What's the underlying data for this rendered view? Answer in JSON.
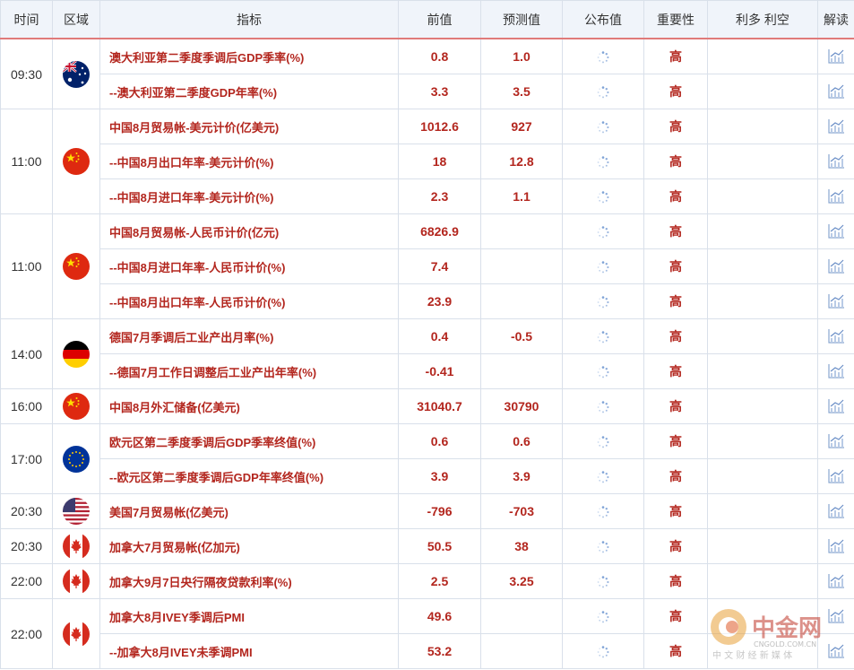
{
  "header": {
    "time": "时间",
    "region": "区域",
    "indicator": "指标",
    "previous": "前值",
    "forecast": "预测值",
    "actual": "公布值",
    "importance": "重要性",
    "effect": "利多 利空",
    "analysis": "解读"
  },
  "groups": [
    {
      "time": "09:30",
      "flag": "australia-flag",
      "rows": [
        {
          "indicator": "澳大利亚第二季度季调后GDP季率(%)",
          "previous": "0.8",
          "forecast": "1.0",
          "importance": "高"
        },
        {
          "indicator": "--澳大利亚第二季度GDP年率(%)",
          "previous": "3.3",
          "forecast": "3.5",
          "importance": "高"
        }
      ]
    },
    {
      "time": "11:00",
      "flag": "china-flag",
      "rows": [
        {
          "indicator": "中国8月贸易帐-美元计价(亿美元)",
          "previous": "1012.6",
          "forecast": "927",
          "importance": "高"
        },
        {
          "indicator": "--中国8月出口年率-美元计价(%)",
          "previous": "18",
          "forecast": "12.8",
          "importance": "高"
        },
        {
          "indicator": "--中国8月进口年率-美元计价(%)",
          "previous": "2.3",
          "forecast": "1.1",
          "importance": "高"
        }
      ]
    },
    {
      "time": "11:00",
      "flag": "china-flag",
      "rows": [
        {
          "indicator": "中国8月贸易帐-人民币计价(亿元)",
          "previous": "6826.9",
          "forecast": "",
          "importance": "高"
        },
        {
          "indicator": "--中国8月进口年率-人民币计价(%)",
          "previous": "7.4",
          "forecast": "",
          "importance": "高"
        },
        {
          "indicator": "--中国8月出口年率-人民币计价(%)",
          "previous": "23.9",
          "forecast": "",
          "importance": "高"
        }
      ]
    },
    {
      "time": "14:00",
      "flag": "germany-flag",
      "rows": [
        {
          "indicator": "德国7月季调后工业产出月率(%)",
          "previous": "0.4",
          "forecast": "-0.5",
          "importance": "高"
        },
        {
          "indicator": "--德国7月工作日调整后工业产出年率(%)",
          "previous": "-0.41",
          "forecast": "",
          "importance": "高"
        }
      ]
    },
    {
      "time": "16:00",
      "flag": "china-flag",
      "rows": [
        {
          "indicator": "中国8月外汇储备(亿美元)",
          "previous": "31040.7",
          "forecast": "30790",
          "importance": "高"
        }
      ]
    },
    {
      "time": "17:00",
      "flag": "eu-flag",
      "rows": [
        {
          "indicator": "欧元区第二季度季调后GDP季率终值(%)",
          "previous": "0.6",
          "forecast": "0.6",
          "importance": "高"
        },
        {
          "indicator": "--欧元区第二季度季调后GDP年率终值(%)",
          "previous": "3.9",
          "forecast": "3.9",
          "importance": "高"
        }
      ]
    },
    {
      "time": "20:30",
      "flag": "usa-flag",
      "rows": [
        {
          "indicator": "美国7月贸易帐(亿美元)",
          "previous": "-796",
          "forecast": "-703",
          "importance": "高"
        }
      ]
    },
    {
      "time": "20:30",
      "flag": "canada-flag",
      "rows": [
        {
          "indicator": "加拿大7月贸易帐(亿加元)",
          "previous": "50.5",
          "forecast": "38",
          "importance": "高"
        }
      ]
    },
    {
      "time": "22:00",
      "flag": "canada-flag",
      "rows": [
        {
          "indicator": "加拿大9月7日央行隔夜贷款利率(%)",
          "previous": "2.5",
          "forecast": "3.25",
          "importance": "高"
        }
      ]
    },
    {
      "time": "22:00",
      "flag": "canada-flag",
      "rows": [
        {
          "indicator": "加拿大8月IVEY季调后PMI",
          "previous": "49.6",
          "forecast": "",
          "importance": "高"
        },
        {
          "indicator": "--加拿大8月IVEY未季调PMI",
          "previous": "53.2",
          "forecast": "",
          "importance": "高"
        }
      ]
    }
  ],
  "watermark": {
    "brand": "中金网",
    "url": "CNGOLD.COM.CN",
    "tagline": "中 文 财 经 新 媒 体"
  },
  "colors": {
    "accent_red": "#b3261e",
    "header_bg": "#f0f4fa",
    "border": "#d9e0ea",
    "icon_blue": "#6b8fc7"
  }
}
